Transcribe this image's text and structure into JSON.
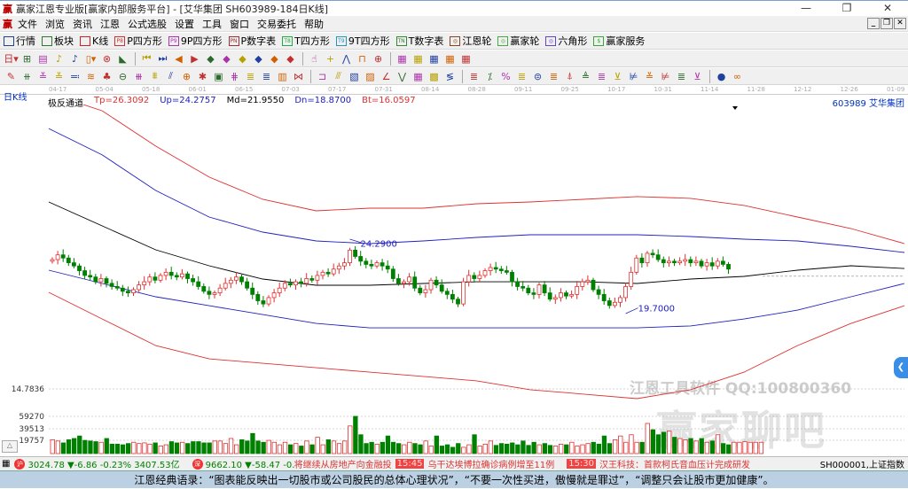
{
  "window": {
    "title": "赢家江恩专业版[赢家内部服务平台] - [艾华集团  SH603989-184日K线]",
    "logo": "赢",
    "controls": [
      "—",
      "❐",
      "✕"
    ]
  },
  "menu": {
    "items": [
      "文件",
      "浏览",
      "资讯",
      "江恩",
      "公式选股",
      "设置",
      "工具",
      "窗口",
      "交易委托",
      "帮助"
    ],
    "mdi_controls": [
      "_",
      "❐",
      "✕"
    ]
  },
  "toolbar1": [
    {
      "label": "行情",
      "icon": "grid-icon",
      "color": "#224488"
    },
    {
      "label": "板块",
      "icon": "blocks-icon",
      "color": "#2a7a2a"
    },
    {
      "label": "K线",
      "icon": "candle-icon",
      "color": "#cc2222"
    },
    {
      "label": "P四方形",
      "icon": "P8",
      "color": "#cc3333"
    },
    {
      "label": "9P四方形",
      "icon": "P9",
      "color": "#aa33aa"
    },
    {
      "label": "P数字表",
      "icon": "PN",
      "color": "#993333"
    },
    {
      "label": "T四方形",
      "icon": "T8",
      "color": "#22aa44"
    },
    {
      "label": "9T四方形",
      "icon": "T9",
      "color": "#2299bb"
    },
    {
      "label": "T数字表",
      "icon": "TN",
      "color": "#338833"
    },
    {
      "label": "江恩轮",
      "icon": "◎",
      "color": "#884422"
    },
    {
      "label": "赢家轮",
      "icon": "◎",
      "color": "#44aa44"
    },
    {
      "label": "六角形",
      "icon": "◎",
      "color": "#6644cc"
    },
    {
      "label": "赢家服务",
      "icon": "$",
      "color": "#33aa33"
    }
  ],
  "toolbar2_icons": [
    "日▾",
    "⊞",
    "▤",
    "♪",
    "♪",
    "▯▾",
    "⊗",
    "◣",
    "|",
    "⏮",
    "⏭",
    "◀",
    "▶",
    "◆",
    "◆",
    "◆",
    "◆",
    "◆",
    "◆",
    "|",
    "☝",
    "+",
    "⋀",
    "⊓",
    "⊕",
    "|",
    "▦",
    "▦",
    "▦",
    "▦",
    "▦"
  ],
  "toolbar3_icons": [
    "✎",
    "⧺",
    "≚",
    "≚",
    "≕",
    "≋",
    "♣",
    "⊖",
    "⧻",
    "⩩",
    "⫽",
    "⊕",
    "✱",
    "▣",
    "⋕",
    "≣",
    "≣",
    "▥",
    "⋈",
    "|",
    "⊐",
    "⫻",
    "▧",
    "▨",
    "∠",
    "⋁",
    "▦",
    "▩",
    "≶",
    "|",
    "≣",
    "⁒",
    "%",
    "≣",
    "⊜",
    "≣",
    "⍋",
    "≜",
    "≣",
    "⊻",
    "⊭",
    "≚",
    "⊭",
    "≣",
    "⊻",
    "|",
    "●",
    "∞"
  ],
  "chart": {
    "period_label": "日K线",
    "indicator": {
      "name": "极反通道",
      "tp": "Tp=26.3092",
      "up": "Up=24.2757",
      "md": "Md=21.9550",
      "dn": "Dn=18.8700",
      "bt": "Bt=16.0597"
    },
    "stock": "603989  艾华集团",
    "date_ticks": [
      "04-17",
      "05-04",
      "05-18",
      "06-01",
      "06-15",
      "07-03",
      "07-17",
      "07-31",
      "08-14",
      "08-28",
      "09-11",
      "09-25",
      "10-17",
      "10-31",
      "11-14",
      "11-28",
      "12-12",
      "12-26",
      "01-09"
    ],
    "high_label": "24.2900",
    "low_label": "19.7000",
    "price_axis_label": "14.7836",
    "volume_ticks": [
      "59270",
      "39513",
      "19757"
    ],
    "colors": {
      "up": "#e03030",
      "down": "#008000",
      "tp": "#e03030",
      "up_line": "#2020c0",
      "md": "#000000",
      "dn": "#2020c0",
      "bt": "#e03030"
    }
  },
  "chart_data": {
    "type": "candlestick",
    "closes": [
      23.0,
      23.3,
      23.1,
      22.8,
      22.6,
      22.3,
      22.0,
      21.9,
      21.6,
      21.8,
      21.5,
      21.3,
      21.2,
      21.0,
      20.9,
      21.1,
      21.4,
      21.6,
      21.9,
      21.7,
      22.0,
      22.2,
      22.0,
      21.9,
      22.1,
      21.8,
      21.6,
      21.3,
      21.0,
      20.8,
      20.9,
      21.2,
      21.5,
      21.7,
      21.9,
      21.6,
      21.2,
      20.8,
      20.4,
      20.2,
      20.6,
      20.9,
      21.2,
      21.5,
      21.4,
      21.6,
      21.5,
      21.8,
      21.7,
      22.0,
      22.2,
      22.1,
      22.4,
      22.6,
      22.8,
      23.6,
      23.2,
      22.9,
      22.7,
      22.6,
      22.8,
      22.6,
      22.4,
      21.8,
      21.5,
      21.6,
      21.9,
      21.2,
      20.9,
      21.1,
      21.7,
      21.4,
      21.0,
      20.8,
      20.5,
      20.2,
      21.6,
      22.0,
      21.8,
      22.0,
      22.3,
      22.5,
      22.4,
      22.3,
      22.2,
      21.6,
      21.3,
      21.2,
      20.9,
      20.8,
      21.4,
      20.9,
      20.5,
      20.6,
      20.9,
      20.7,
      20.8,
      21.3,
      21.6,
      21.7,
      21.1,
      20.8,
      20.4,
      20.1,
      20.3,
      20.6,
      21.3,
      22.2,
      23.1,
      22.8,
      23.4,
      23.3,
      23.0,
      22.8,
      22.9,
      22.8,
      22.9,
      23.0,
      22.8,
      22.9,
      22.6,
      22.8,
      22.6,
      22.9,
      22.7,
      22.4
    ],
    "volumes": [
      22000,
      20000,
      17000,
      22000,
      24000,
      28000,
      21000,
      20000,
      19000,
      18000,
      24000,
      15000,
      15000,
      14000,
      16000,
      18000,
      16000,
      17000,
      15000,
      17000,
      12000,
      14000,
      19000,
      17000,
      18000,
      16000,
      19000,
      19000,
      17000,
      17000,
      20000,
      20000,
      16000,
      24000,
      14000,
      22000,
      20000,
      32000,
      20000,
      18000,
      21000,
      18000,
      14000,
      18000,
      14000,
      16000,
      12000,
      20000,
      14000,
      26000,
      14000,
      22000,
      20000,
      16000,
      20000,
      44000,
      59270,
      30000,
      16000,
      18000,
      15000,
      18000,
      28000,
      18000,
      16000,
      14000,
      18000,
      16000,
      14000,
      20000,
      12000,
      28000,
      12000,
      14000,
      10000,
      16000,
      10000,
      14000,
      30000,
      12000,
      15000,
      20000,
      13000,
      16000,
      15000,
      17000,
      14000,
      20000,
      13000,
      18000,
      14000,
      16000,
      13000,
      12000,
      15000,
      14000,
      18000,
      12000,
      14000,
      16000,
      18000,
      15000,
      28000,
      16000,
      22000,
      28000,
      18000,
      30000,
      18000,
      18000,
      48000,
      38000,
      30000,
      34000,
      36000,
      26000,
      24000,
      22000,
      24000,
      20000,
      24000,
      18000,
      20000,
      30000,
      16000,
      14000,
      18000,
      18000,
      19000,
      18000,
      18000,
      18000
    ],
    "channels": {
      "Tp": [
        33.52,
        32.4,
        30.17,
        28.21,
        26.81,
        26.08,
        26.25,
        26.25,
        26.53,
        26.64,
        26.81,
        26.98,
        26.87,
        26.42,
        25.69,
        24.96,
        24.01
      ],
      "Up": [
        31.28,
        29.61,
        27.37,
        25.69,
        24.74,
        24.18,
        24.01,
        24.18,
        24.4,
        24.57,
        24.57,
        24.57,
        24.46,
        24.29,
        24.18,
        23.84,
        23.45
      ],
      "Md": [
        26.64,
        25.13,
        23.62,
        22.61,
        21.77,
        21.38,
        21.38,
        21.49,
        21.6,
        21.6,
        21.6,
        21.49,
        21.77,
        21.94,
        22.33,
        22.61,
        22.44
      ],
      "Dn": [
        22.33,
        21.49,
        20.65,
        20.09,
        19.53,
        18.97,
        18.69,
        18.69,
        18.69,
        18.69,
        18.69,
        18.69,
        18.81,
        19.25,
        19.81,
        20.65,
        21.49
      ],
      "Bt": [
        20.93,
        19.25,
        17.57,
        16.73,
        16.45,
        16.17,
        15.89,
        15.62,
        15.34,
        14.78,
        14.5,
        14.22,
        14.78,
        15.89,
        17.57,
        18.97,
        20.09
      ]
    }
  },
  "watermark": {
    "line1": "江恩工具软件  QQ:100800360",
    "line2": "赢家聊吧"
  },
  "status": {
    "sh_icon": "沪",
    "sh": "3024.78 ▼-6.86 -0.23% 3407.53亿",
    "sz_icon": "深",
    "sz": "9662.10 ▼-58.47 -0.60% 5009.91亿",
    "news1": "将继续从房地产向金融投",
    "time1": "15:45",
    "news2": "乌干达埃博拉确诊病例增至11例",
    "time2": "15:30",
    "news3": "汉王科技：首款柯氏音血压计完成研发",
    "index": "SH000001,上证指数"
  },
  "quote": "江恩经典语录：“图表能反映出一切股市或公司股民的总体心理状况”，“不要一次性买进，傲慢就是罪过”，“调整只会让股市更加健康”。"
}
